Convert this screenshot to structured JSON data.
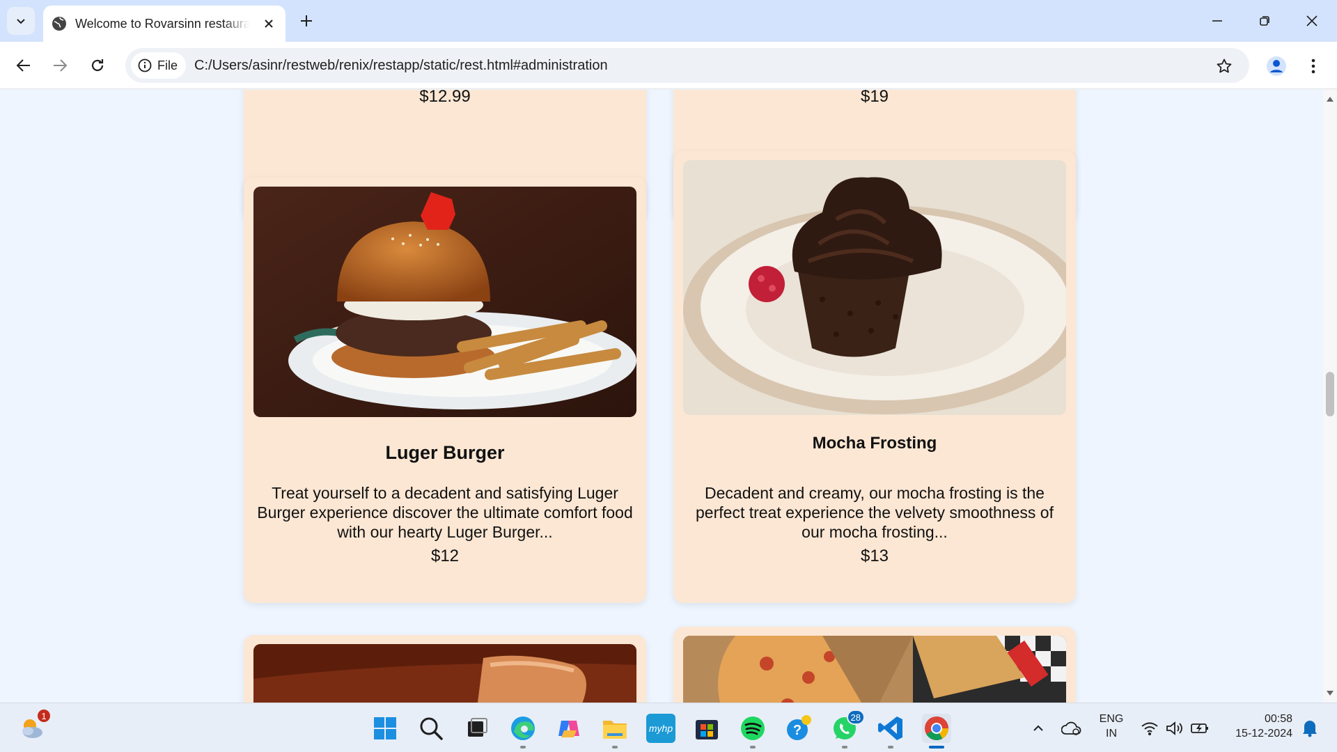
{
  "browser": {
    "tab_title": "Welcome to Rovarsinn restaurant",
    "new_tab_label": "+",
    "site_info_label": "File",
    "url": "C:/Users/asinr/restweb/renix/restapp/static/rest.html#administration"
  },
  "menu": {
    "top_prices": [
      "$12.99",
      "$19"
    ],
    "items": [
      {
        "name": "Luger Burger",
        "description": "Treat yourself to a decadent and satisfying Luger Burger experience discover the ultimate comfort food with our hearty Luger Burger...",
        "price": "$12"
      },
      {
        "name": "Mocha Frosting",
        "description": "Decadent and creamy, our mocha frosting is the perfect treat experience the velvety smoothness of our mocha frosting...",
        "price": "$13"
      }
    ]
  },
  "taskbar": {
    "weather_badge": "1",
    "whatsapp_badge": "28",
    "language_line1": "ENG",
    "language_line2": "IN",
    "time": "00:58",
    "date": "15-12-2024",
    "myhp_label": "myhp"
  },
  "colors": {
    "card_bg": "#fbe7d4",
    "page_bg": "#eef5ff",
    "tabstrip_bg": "#d3e3fd",
    "accent": "#0067c0"
  }
}
